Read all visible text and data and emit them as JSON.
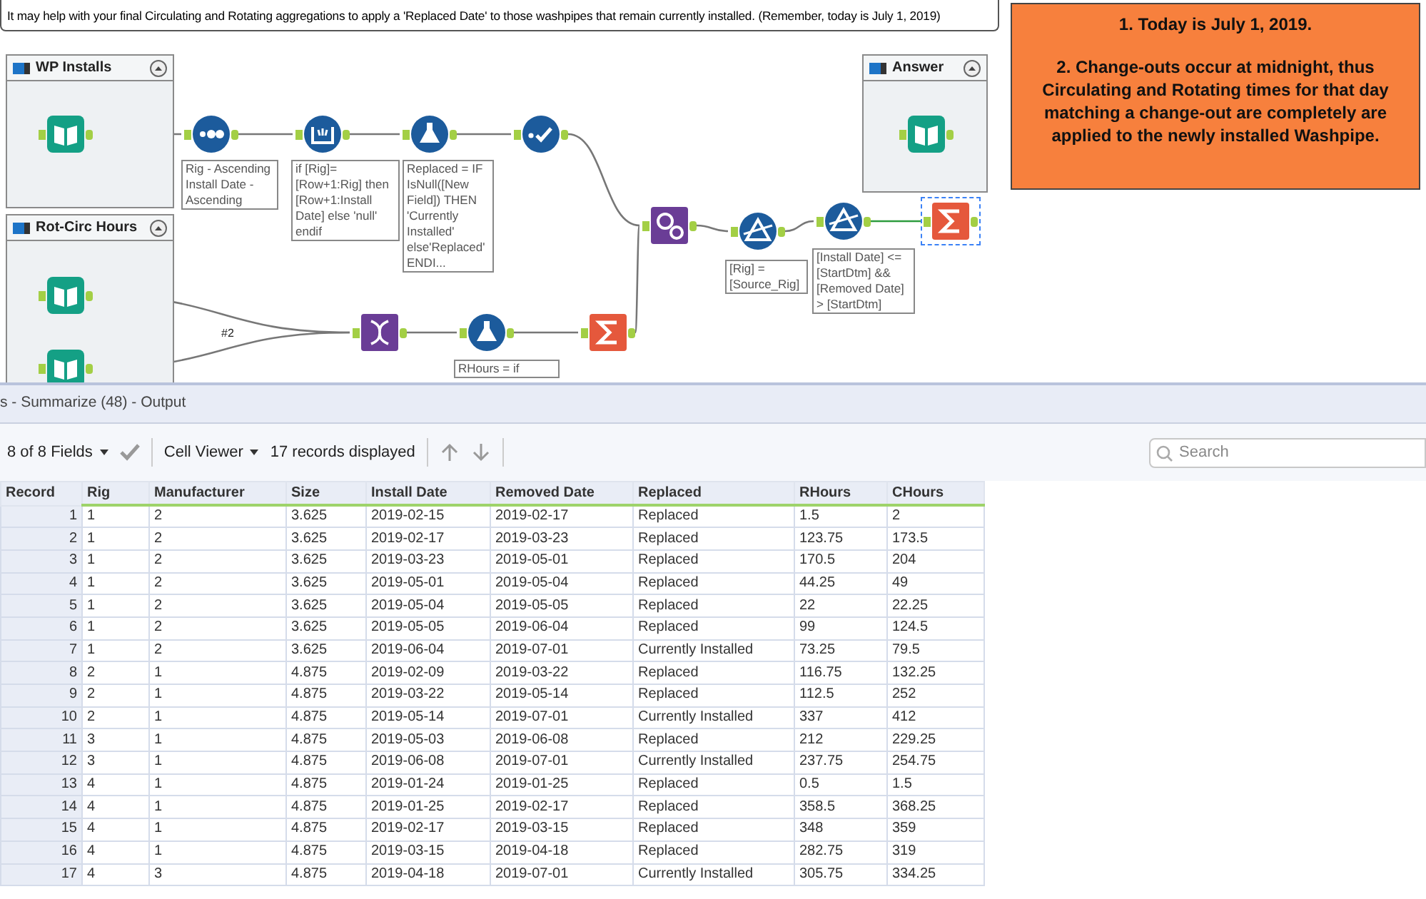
{
  "canvas": {
    "comment": "It may help with your final Circulating and Rotating aggregations to apply a 'Replaced Date' to those washpipes that remain currently installed. (Remember, today is July 1, 2019)",
    "note": [
      "1. Today is July 1, 2019.",
      "2. Change-outs occur at midnight, thus Circulating and Rotating times for that day matching a change-out are completely are applied to the newly installed Washpipe."
    ],
    "containers": [
      {
        "title": "WP Installs"
      },
      {
        "title": "Rot-Circ Hours"
      },
      {
        "title": "Answer"
      }
    ],
    "tools": [
      {
        "kind": "input",
        "selected": false
      },
      {
        "kind": "sort",
        "selected": false,
        "annotation": "Rig - Ascending Install Date - Ascending"
      },
      {
        "kind": "multirow",
        "selected": false,
        "annotation": "if [Rig]=[Row+1:Rig] then [Row+1:Install Date] else 'null' endif"
      },
      {
        "kind": "formula",
        "selected": false,
        "annotation": "Replaced = IF IsNull([New Field]) THEN 'Currently Installed' else'Replaced' ENDI..."
      },
      {
        "kind": "select",
        "selected": false
      },
      {
        "kind": "join",
        "selected": false
      },
      {
        "kind": "filter",
        "selected": false,
        "annotation": "[Rig] = [Source_Rig]"
      },
      {
        "kind": "filter",
        "selected": false,
        "annotation": "[Install Date] <= [StartDtm] && [Removed Date] > [StartDtm]"
      },
      {
        "kind": "summarize",
        "selected": true
      },
      {
        "kind": "input",
        "selected": false
      },
      {
        "kind": "input",
        "selected": false
      },
      {
        "kind": "transpose",
        "selected": false
      },
      {
        "kind": "formula",
        "selected": false,
        "annotation": "RHours = if"
      },
      {
        "kind": "summarize",
        "selected": false
      },
      {
        "kind": "input",
        "selected": false
      }
    ],
    "wire_label": "#2"
  },
  "results": {
    "title": "s - Summarize (48) - Output",
    "fields": "8 of 8 Fields",
    "viewer": "Cell Viewer",
    "records": "17 records displayed",
    "search": {
      "placeholder": "Search"
    },
    "table": {
      "columns": [
        "Record",
        "Rig",
        "Manufacturer",
        "Size",
        "Install Date",
        "Removed Date",
        "Replaced",
        "RHours",
        "CHours"
      ],
      "rows": [
        [
          "1",
          "1",
          "2",
          "3.625",
          "2019-02-15",
          "2019-02-17",
          "Replaced",
          "1.5",
          "2"
        ],
        [
          "2",
          "1",
          "2",
          "3.625",
          "2019-02-17",
          "2019-03-23",
          "Replaced",
          "123.75",
          "173.5"
        ],
        [
          "3",
          "1",
          "2",
          "3.625",
          "2019-03-23",
          "2019-05-01",
          "Replaced",
          "170.5",
          "204"
        ],
        [
          "4",
          "1",
          "2",
          "3.625",
          "2019-05-01",
          "2019-05-04",
          "Replaced",
          "44.25",
          "49"
        ],
        [
          "5",
          "1",
          "2",
          "3.625",
          "2019-05-04",
          "2019-05-05",
          "Replaced",
          "22",
          "22.25"
        ],
        [
          "6",
          "1",
          "2",
          "3.625",
          "2019-05-05",
          "2019-06-04",
          "Replaced",
          "99",
          "124.5"
        ],
        [
          "7",
          "1",
          "2",
          "3.625",
          "2019-06-04",
          "2019-07-01",
          "Currently Installed",
          "73.25",
          "79.5"
        ],
        [
          "8",
          "2",
          "1",
          "4.875",
          "2019-02-09",
          "2019-03-22",
          "Replaced",
          "116.75",
          "132.25"
        ],
        [
          "9",
          "2",
          "1",
          "4.875",
          "2019-03-22",
          "2019-05-14",
          "Replaced",
          "112.5",
          "252"
        ],
        [
          "10",
          "2",
          "1",
          "4.875",
          "2019-05-14",
          "2019-07-01",
          "Currently Installed",
          "337",
          "412"
        ],
        [
          "11",
          "3",
          "1",
          "4.875",
          "2019-05-03",
          "2019-06-08",
          "Replaced",
          "212",
          "229.25"
        ],
        [
          "12",
          "3",
          "1",
          "4.875",
          "2019-06-08",
          "2019-07-01",
          "Currently Installed",
          "237.75",
          "254.75"
        ],
        [
          "13",
          "4",
          "1",
          "4.875",
          "2019-01-24",
          "2019-01-25",
          "Replaced",
          "0.5",
          "1.5"
        ],
        [
          "14",
          "4",
          "1",
          "4.875",
          "2019-01-25",
          "2019-02-17",
          "Replaced",
          "358.5",
          "368.25"
        ],
        [
          "15",
          "4",
          "1",
          "4.875",
          "2019-02-17",
          "2019-03-15",
          "Replaced",
          "348",
          "359"
        ],
        [
          "16",
          "4",
          "1",
          "4.875",
          "2019-03-15",
          "2019-04-18",
          "Replaced",
          "282.75",
          "319"
        ],
        [
          "17",
          "4",
          "3",
          "4.875",
          "2019-04-18",
          "2019-07-01",
          "Currently Installed",
          "305.75",
          "334.25"
        ]
      ]
    }
  }
}
